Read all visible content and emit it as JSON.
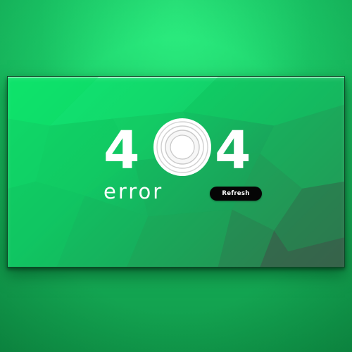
{
  "error_page": {
    "code_left_digit": "4",
    "code_right_digit": "4",
    "error_label": "error",
    "refresh_label": "Refresh"
  },
  "theme": {
    "accent": "#1fe074",
    "panel_dark": "#2f6f4d",
    "button_bg": "#050505",
    "text": "#ffffff"
  }
}
